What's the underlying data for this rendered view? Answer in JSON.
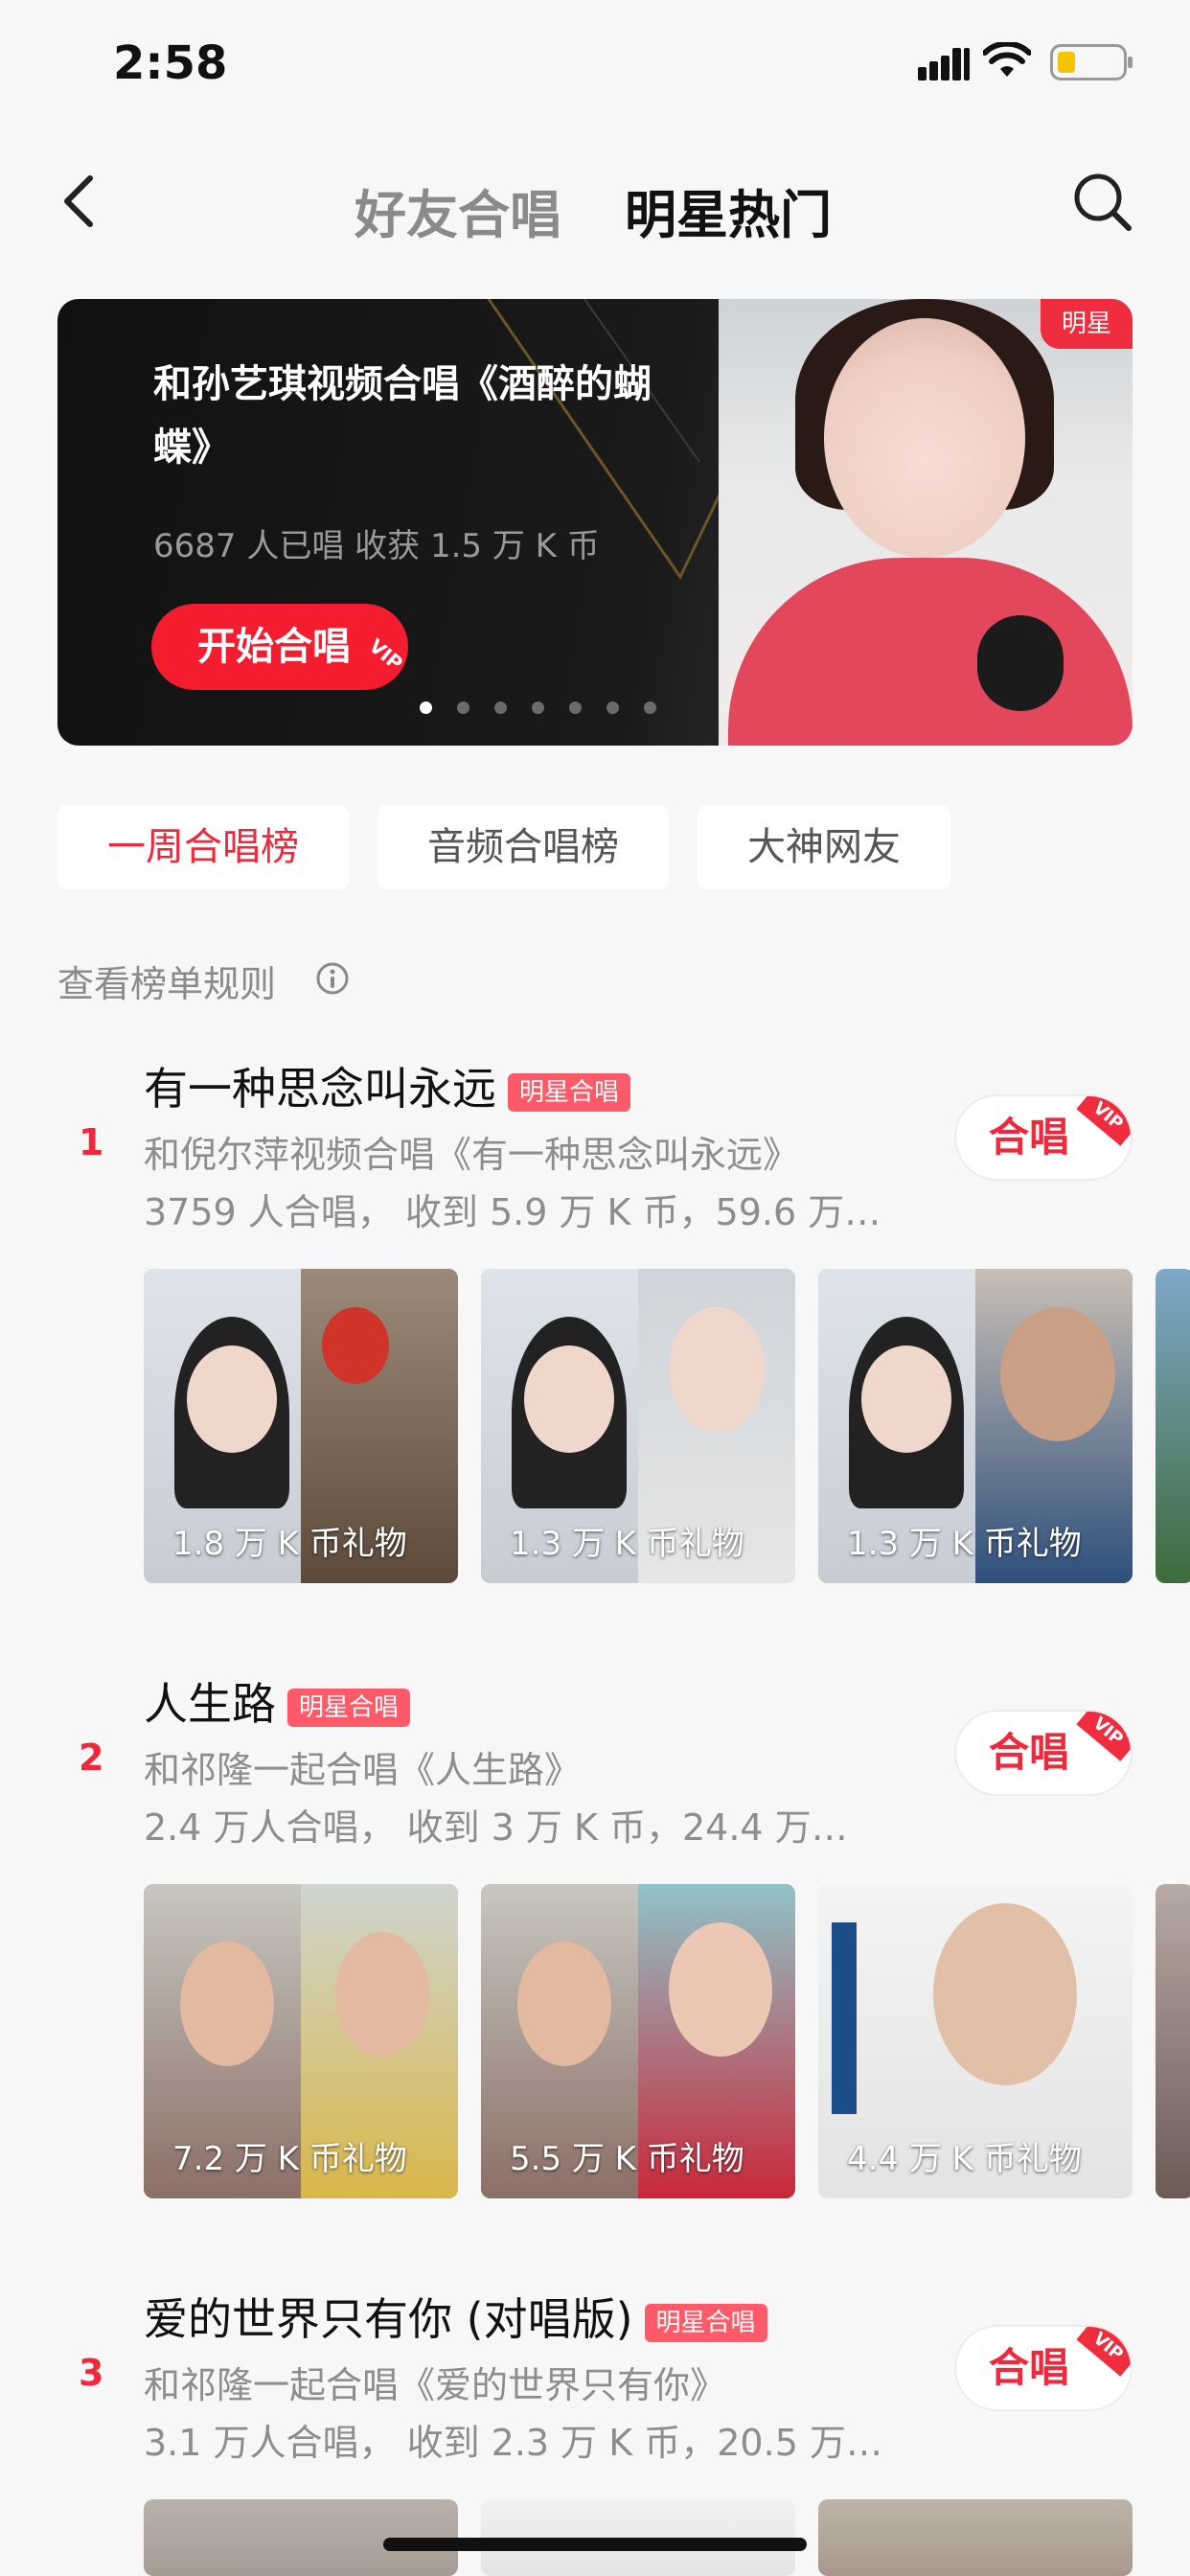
{
  "status": {
    "time": "2:58"
  },
  "nav": {
    "tab_friends": "好友合唱",
    "tab_stars": "明星热门"
  },
  "banner": {
    "tag": "明星",
    "title": "和孙艺琪视频合唱《酒醉的蝴蝶》",
    "stats": "6687 人已唱 收获 1.5 万 K 币",
    "cta": "开始合唱",
    "cta_badge": "VIP",
    "page_count": 7,
    "active_page": 1
  },
  "chips": [
    "一周合唱榜",
    "音频合唱榜",
    "大神网友"
  ],
  "rules": "查看榜单规则",
  "join_label": "合唱",
  "vip_label": "VIP",
  "items": [
    {
      "rank": "1",
      "song": "有一种思念叫永远",
      "badge": "明星合唱",
      "line1": "和倪尔萍视频合唱《有一种思念叫永远》",
      "line2": "3759 人合唱， 收到 5.9 万 K 币，59.6 万…",
      "gifts": [
        "1.8 万 K 币礼物",
        "1.3 万 K 币礼物",
        "1.3 万 K 币礼物"
      ]
    },
    {
      "rank": "2",
      "song": "人生路",
      "badge": "明星合唱",
      "line1": "和祁隆一起合唱《人生路》",
      "line2": "2.4 万人合唱， 收到 3 万 K 币，24.4 万…",
      "gifts": [
        "7.2 万 K 币礼物",
        "5.5 万 K 币礼物",
        "4.4 万 K 币礼物"
      ]
    },
    {
      "rank": "3",
      "song": "爱的世界只有你 (对唱版)",
      "badge": "明星合唱",
      "line1": "和祁隆一起合唱《爱的世界只有你》",
      "line2": "3.1 万人合唱， 收到 2.3 万 K 币，20.5 万…",
      "gifts": []
    }
  ]
}
